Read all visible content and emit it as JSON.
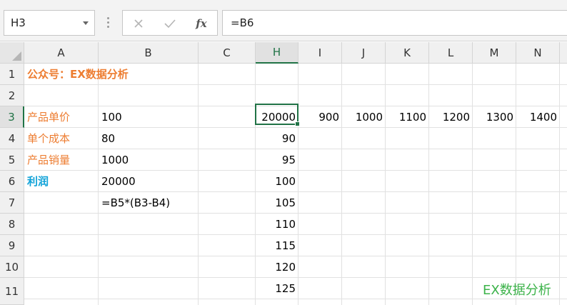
{
  "formula_bar": {
    "name_box": "H3",
    "formula": "=B6",
    "fx_label": "fx",
    "icons": [
      "cancel-icon",
      "enter-icon",
      "fx-icon"
    ]
  },
  "columns": [
    "A",
    "B",
    "C",
    "H",
    "I",
    "J",
    "K",
    "L",
    "M",
    "N"
  ],
  "active_column": "H",
  "rows": [
    "1",
    "2",
    "3",
    "4",
    "5",
    "6",
    "7",
    "8",
    "9",
    "10",
    "11"
  ],
  "active_row": "3",
  "cells": {
    "A1": "公众号：EX数据分析",
    "A3": "产品单价",
    "B3": "100",
    "A4": "单个成本",
    "B4": "80",
    "A5": "产品销量",
    "B5": "1000",
    "A6": "利润",
    "B6": "20000",
    "B7": "=B5*(B3-B4)",
    "H3": "20000",
    "I3": "900",
    "J3": "1000",
    "K3": "1100",
    "L3": "1200",
    "M3": "1300",
    "N3": "1400",
    "H4": "90",
    "H5": "95",
    "H6": "100",
    "H7": "105",
    "H8": "110",
    "H9": "115",
    "H10": "120",
    "H11": "125"
  },
  "watermark": "EX数据分析",
  "colors": {
    "accent": "#217346",
    "label_orange": "#ed7d31",
    "label_blue": "#0fa2d8",
    "watermark_green": "#3cb34a"
  }
}
